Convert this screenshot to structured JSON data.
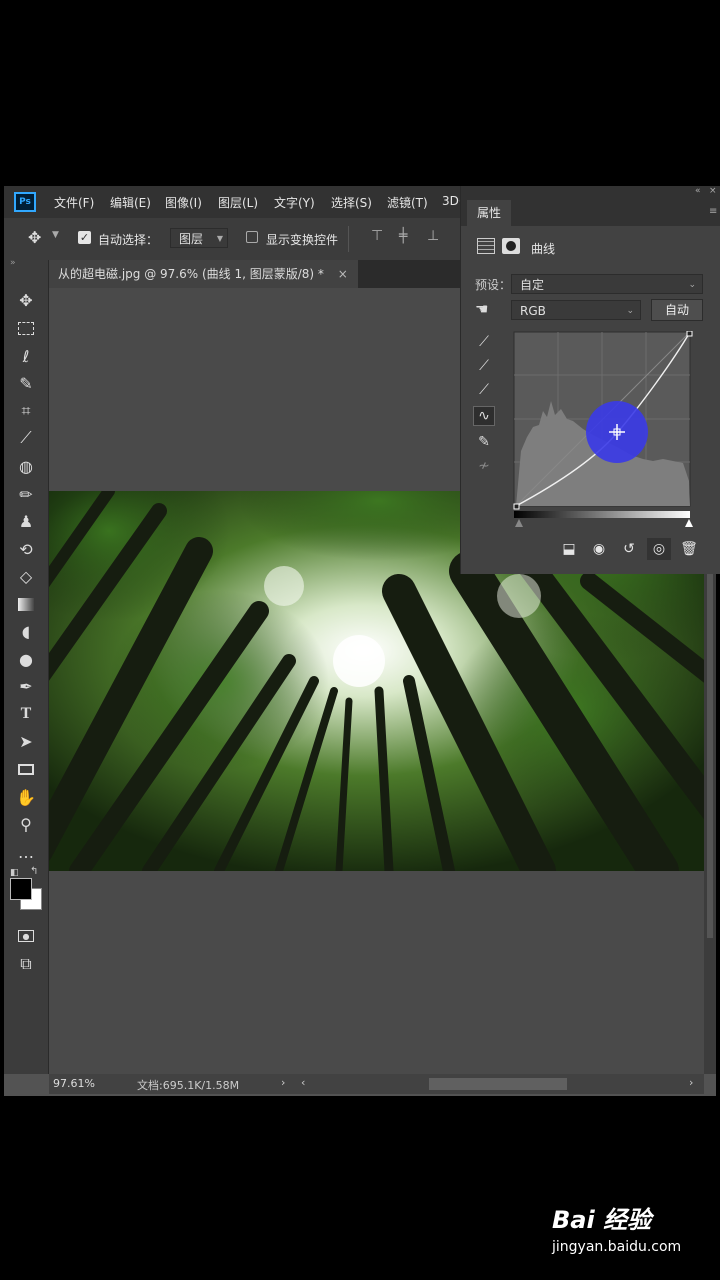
{
  "menu": [
    "文件(F)",
    "编辑(E)",
    "图像(I)",
    "图层(L)",
    "文字(Y)",
    "选择(S)",
    "滤镜(T)",
    "3D("
  ],
  "app_logo": "Ps",
  "options": {
    "auto_select_label": "自动选择：",
    "auto_select_value": "图层",
    "show_transform_label": "显示变换控件"
  },
  "document_tab": "从的超电磁.jpg @ 97.6% (曲线 1, 图层蒙版/8) *",
  "close_glyph": "×",
  "status": {
    "zoom": "97.61%",
    "doc": "文档:695.1K/1.58M"
  },
  "panel": {
    "tab": "属性",
    "title": "曲线",
    "preset_label": "预设：",
    "preset_value": "自定",
    "channel": "RGB",
    "auto_button": "自动"
  },
  "tools": [
    "move-icon",
    "marquee-icon",
    "lasso-icon",
    "quick-select-icon",
    "crop-icon",
    "eyedropper-icon",
    "healing-icon",
    "brush-icon",
    "stamp-icon",
    "history-brush-icon",
    "eraser-icon",
    "gradient-icon",
    "blur-icon",
    "dodge-icon",
    "pen-icon",
    "type-icon",
    "path-select-icon",
    "rectangle-icon",
    "hand-icon",
    "zoom-icon",
    "more-icon"
  ],
  "watermark": {
    "brand": "Bai 经验",
    "url": "jingyan.baidu.com"
  },
  "colors": {
    "accent": "#31a8ff",
    "cursor_highlight": "#3a3ae8"
  }
}
